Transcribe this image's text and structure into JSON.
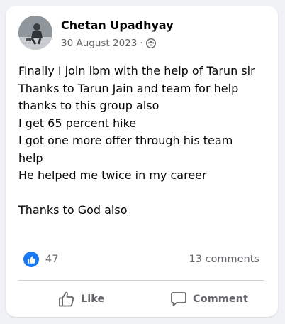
{
  "post": {
    "author": "Chetan Upadhyay",
    "date": "30 August 2023",
    "separator": "·",
    "audience_icon": "group-audience-icon",
    "avatar_icon": "profile-photo",
    "lines": [
      "Finally I join ibm with the help of Tarun sir",
      "Thanks to Tarun Jain and team for help",
      "thanks to this group also",
      "I get 65 percent hike",
      "I got one more offer through his team",
      "help",
      "He helped me twice in my career",
      "",
      "Thanks to God also"
    ]
  },
  "stats": {
    "reaction_icon": "like-reaction-icon",
    "reaction_count": "47",
    "comments": "13 comments"
  },
  "actions": {
    "like_label": "Like",
    "like_icon": "thumbs-up-icon",
    "comment_label": "Comment",
    "comment_icon": "speech-bubble-icon"
  },
  "colors": {
    "accent": "#1877f2",
    "secondary_text": "#65676b",
    "background": "#f0f2f5"
  }
}
